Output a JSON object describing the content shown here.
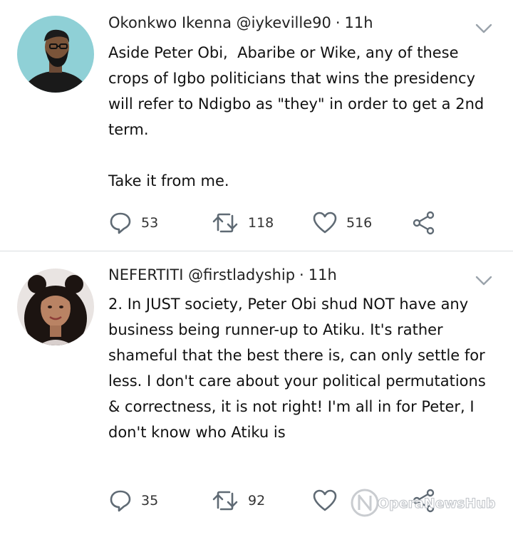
{
  "tweets": [
    {
      "author_name": "Okonkwo Ikenna",
      "handle": "@iykeville90",
      "time": "11h",
      "text": "Aside Peter Obi,  Abaribe or Wike, any of these crops of Igbo politicians that wins the presidency will refer to Ndigbo as \"they\" in order to get a 2nd term.\n\nTake it from me.",
      "replies": "53",
      "retweets": "118",
      "likes": "516"
    },
    {
      "author_name": "NEFERTITI",
      "handle": "@firstladyship",
      "time": "11h",
      "text": "2. In JUST society, Peter Obi shud NOT have any business being runner-up to Atiku. It's rather shameful that the best there is, can only settle for less. I don't care about your political permutations & correctness, it is not right! I'm all in for Peter, I don't know who Atiku is",
      "replies": "35",
      "retweets": "92"
    }
  ],
  "watermark": "OperaNewsHub",
  "icons": [
    "reply-icon",
    "retweet-icon",
    "like-icon",
    "share-icon",
    "chevron-down-icon"
  ]
}
